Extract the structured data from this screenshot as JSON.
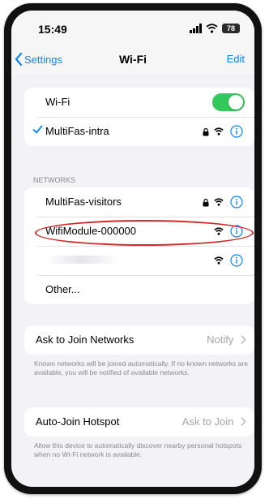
{
  "status_bar": {
    "time": "15:49",
    "battery": "78"
  },
  "nav": {
    "back_label": "Settings",
    "title": "Wi-Fi",
    "edit_label": "Edit"
  },
  "wifi_toggle": {
    "label": "Wi-Fi",
    "state": "on",
    "accent": "#34c759"
  },
  "connected_network": {
    "name": "MultiFas-intra",
    "secured": true
  },
  "networks_section": {
    "header": "NETWORKS",
    "items": [
      {
        "name": "MultiFas-visitors",
        "secured": true,
        "highlighted": false
      },
      {
        "name": "WifiModule-000000",
        "secured": false,
        "highlighted": true
      },
      {
        "name": "",
        "secured": false,
        "highlighted": false
      },
      {
        "name": "Other..."
      }
    ]
  },
  "ask_to_join": {
    "label": "Ask to Join Networks",
    "value": "Notify",
    "footnote": "Known networks will be joined automatically. If no known networks are available, you will be notified of available networks."
  },
  "auto_join_hotspot": {
    "label": "Auto-Join Hotspot",
    "value": "Ask to Join",
    "footnote": "Allow this device to automatically discover nearby personal hotspots when no Wi-Fi network is available."
  },
  "colors": {
    "link_blue": "#0a84ff",
    "highlight_red": "#d22a2a"
  },
  "icons": [
    "signal-icon",
    "wifi-icon",
    "battery-icon",
    "back-chevron-icon",
    "checkmark-icon",
    "lock-icon",
    "info-icon",
    "chevron-right-icon"
  ]
}
